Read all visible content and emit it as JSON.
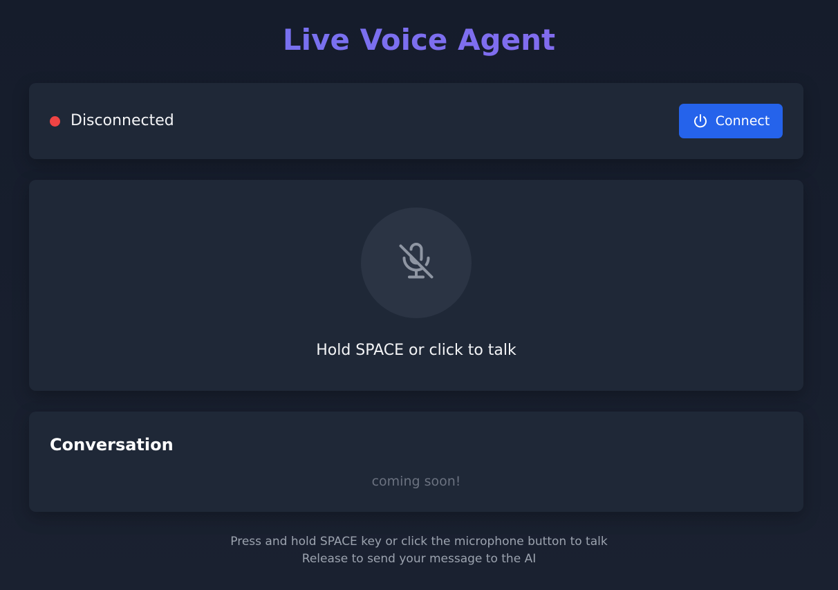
{
  "header": {
    "title": "Live Voice Agent"
  },
  "status": {
    "text": "Disconnected",
    "dot_color": "#ef4444",
    "connect_label": "Connect",
    "connect_icon": "power-icon",
    "button_color": "#2563eb"
  },
  "mic": {
    "icon": "microphone-off-icon",
    "hint": "Hold SPACE or click to talk"
  },
  "conversation": {
    "title": "Conversation",
    "empty_text": "coming soon!"
  },
  "footer": {
    "line1": "Press and hold SPACE key or click the microphone button to talk",
    "line2": "Release to send your message to the AI"
  }
}
